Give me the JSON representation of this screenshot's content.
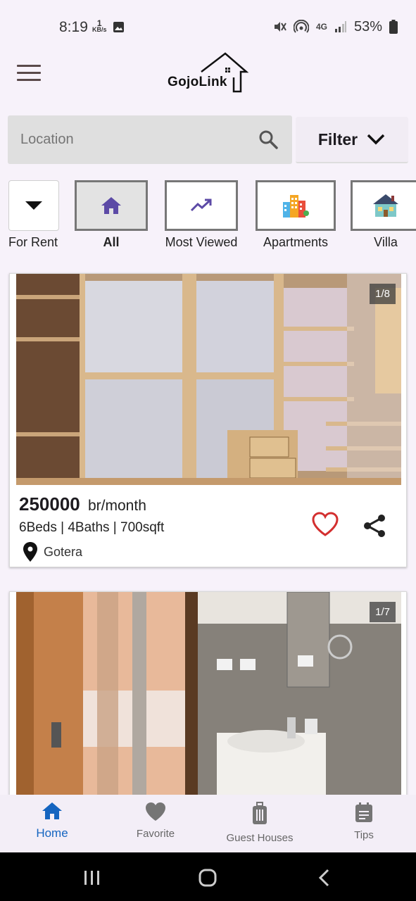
{
  "status_bar": {
    "time": "8:19",
    "net_speed_value": "1",
    "net_speed_unit": "KB/s",
    "network": "4G",
    "battery": "53%"
  },
  "app": {
    "logo_text": "GojoLink",
    "brand_color": "#1565c0",
    "accent_color": "#6750a4"
  },
  "search": {
    "placeholder": "Location",
    "filter_label": "Filter"
  },
  "categories": {
    "listing_type": "For Rent",
    "items": [
      {
        "label": "All",
        "icon": "home-icon",
        "selected": true
      },
      {
        "label": "Most Viewed",
        "icon": "trending-up-icon",
        "selected": false
      },
      {
        "label": "Apartments",
        "icon": "apartments-icon",
        "selected": false
      },
      {
        "label": "Villa",
        "icon": "villa-icon",
        "selected": false
      }
    ]
  },
  "listings": [
    {
      "photo_counter": "1/8",
      "price": "250000",
      "price_unit": "br/month",
      "specs": "6Beds | 4Baths | 700sqft",
      "location": "Gotera"
    },
    {
      "photo_counter": "1/7"
    }
  ],
  "bottom_nav": {
    "items": [
      {
        "label": "Home",
        "icon": "home-icon",
        "active": true
      },
      {
        "label": "Favorite",
        "icon": "heart-icon",
        "active": false
      },
      {
        "label": "Guest Houses",
        "icon": "luggage-icon",
        "active": false
      },
      {
        "label": "Tips",
        "icon": "notes-icon",
        "active": false
      }
    ]
  }
}
